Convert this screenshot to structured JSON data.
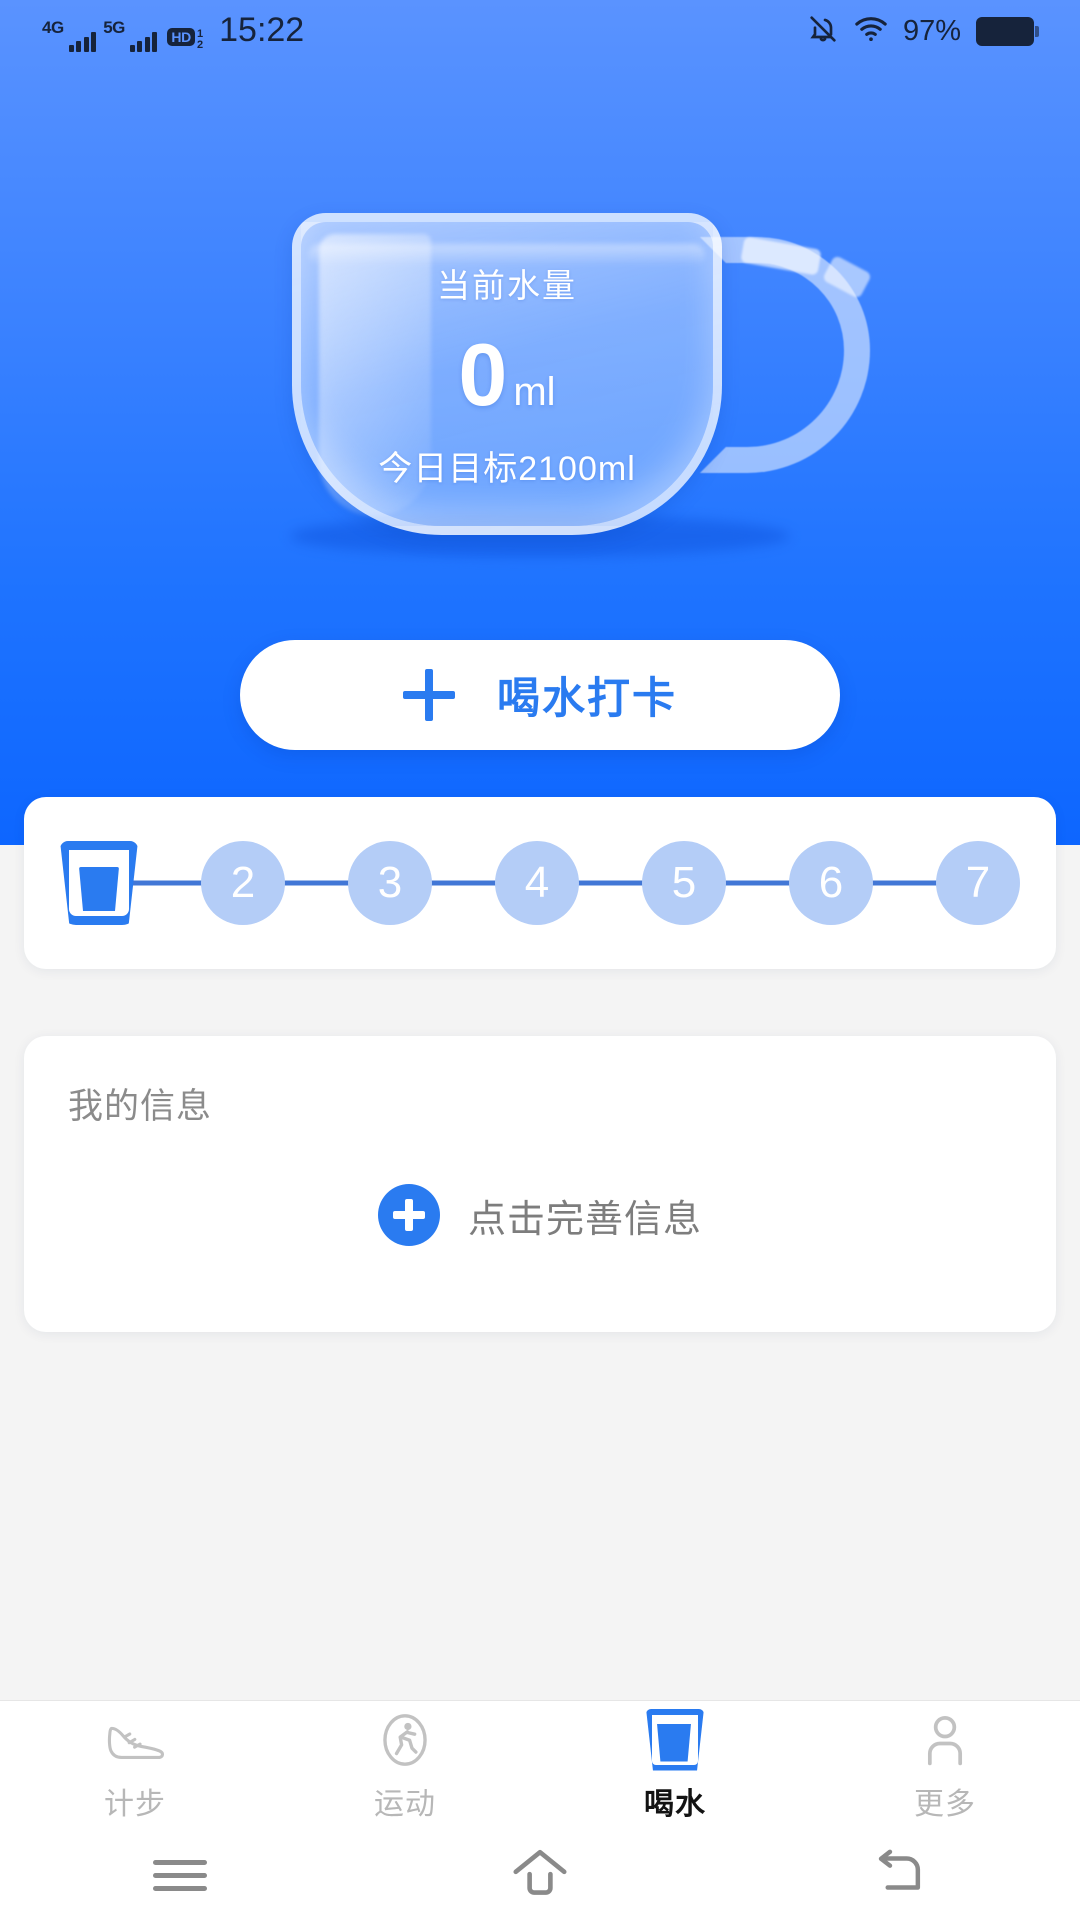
{
  "statusbar": {
    "network_4g": "4G",
    "network_5g": "5G",
    "hd_badge": "HD",
    "hd_num": "1",
    "hd_den": "2",
    "time": "15:22",
    "battery_percent": "97%",
    "icons": [
      "mute-icon",
      "wifi-icon",
      "battery-icon"
    ]
  },
  "header": {
    "cup": {
      "label": "当前水量",
      "amount": "0",
      "unit": "ml",
      "goal": "今日目标2100ml"
    },
    "checkin_button": {
      "icon": "plus-icon",
      "label": "喝水打卡"
    },
    "gradient_top": "#5a93ff",
    "gradient_bottom": "#0d66ff"
  },
  "stepper": {
    "active_icon": "water-glass-icon",
    "steps": [
      "2",
      "3",
      "4",
      "5",
      "6",
      "7"
    ],
    "line_color": "#4277d6",
    "dot_color": "#b4cdf7",
    "accent": "#2a7bf0"
  },
  "info_card": {
    "title": "我的信息",
    "cta_icon": "plus-circle-icon",
    "cta_label": "点击完善信息"
  },
  "bottom_nav": [
    {
      "icon": "shoe-icon",
      "label": "计步",
      "active": false
    },
    {
      "icon": "running-icon",
      "label": "运动",
      "active": false
    },
    {
      "icon": "water-glass-icon",
      "label": "喝水",
      "active": true
    },
    {
      "icon": "person-icon",
      "label": "更多",
      "active": false
    }
  ],
  "android_nav": [
    "recents-icon",
    "home-icon",
    "back-icon"
  ]
}
